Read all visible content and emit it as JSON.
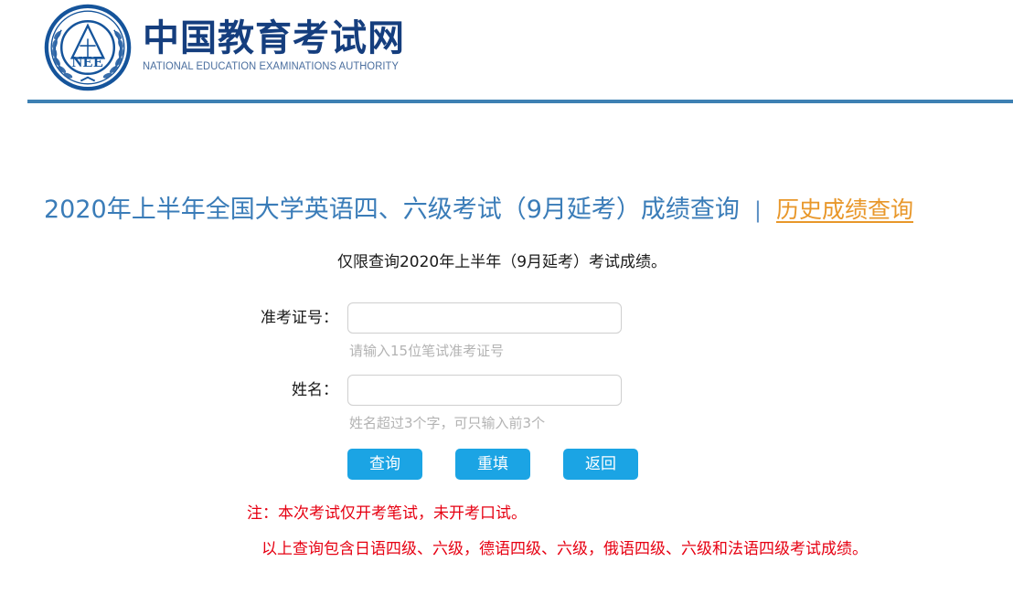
{
  "header": {
    "logo_icon": "nee-emblem-icon",
    "brand_cn": "中国教育考试网",
    "brand_en": "NATIONAL EDUCATION EXAMINATIONS AUTHORITY",
    "rule_color": "#3d80b3"
  },
  "title_bar": {
    "title": "2020年上半年全国大学英语四、六级考试（9月延考）成绩查询",
    "separator": "|",
    "history_link": "历史成绩查询",
    "title_color": "#3a7cb8",
    "link_color": "#e8972a"
  },
  "subtitle": "仅限查询2020年上半年（9月延考）考试成绩。",
  "form": {
    "fields": [
      {
        "label": "准考证号：",
        "value": "",
        "placeholder": "",
        "hint": "请输入15位笔试准考证号"
      },
      {
        "label": "姓名：",
        "value": "",
        "placeholder": "",
        "hint": "姓名超过3个字，可只输入前3个"
      }
    ]
  },
  "buttons": {
    "query": "查询",
    "reset": "重填",
    "back": "返回",
    "color": "#1ba4e4"
  },
  "notes": {
    "note_1": "注：本次考试仅开考笔试，未开考口试。",
    "note_2": "以上查询包含日语四级、六级，德语四级、六级，俄语四级、六级和法语四级考试成绩。",
    "color": "#e60012"
  }
}
